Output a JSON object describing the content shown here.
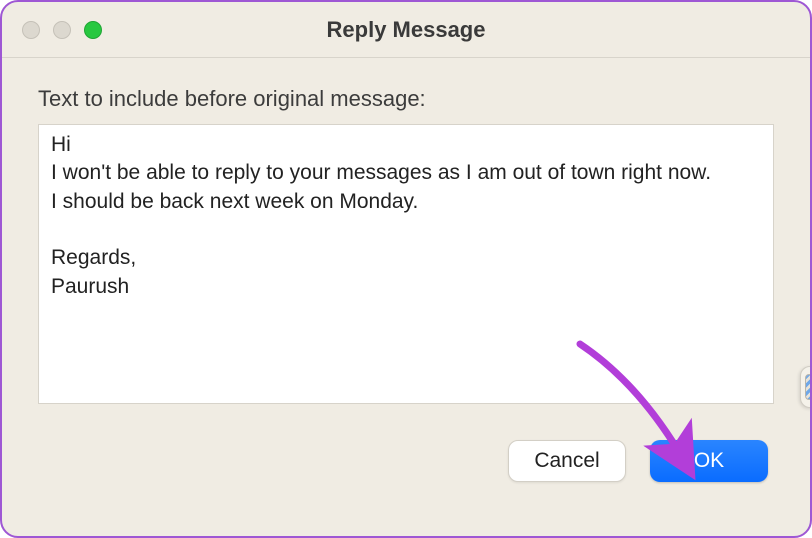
{
  "window": {
    "title": "Reply Message"
  },
  "content": {
    "prompt_label": "Text to include before original message:",
    "message_body": "Hi\nI won't be able to reply to your messages as I am out of town right now.\nI should be back next week on Monday.\n\nRegards,\nPaurush"
  },
  "buttons": {
    "cancel": "Cancel",
    "ok": "OK"
  },
  "annotation": {
    "arrow_color": "#b23ed9"
  }
}
